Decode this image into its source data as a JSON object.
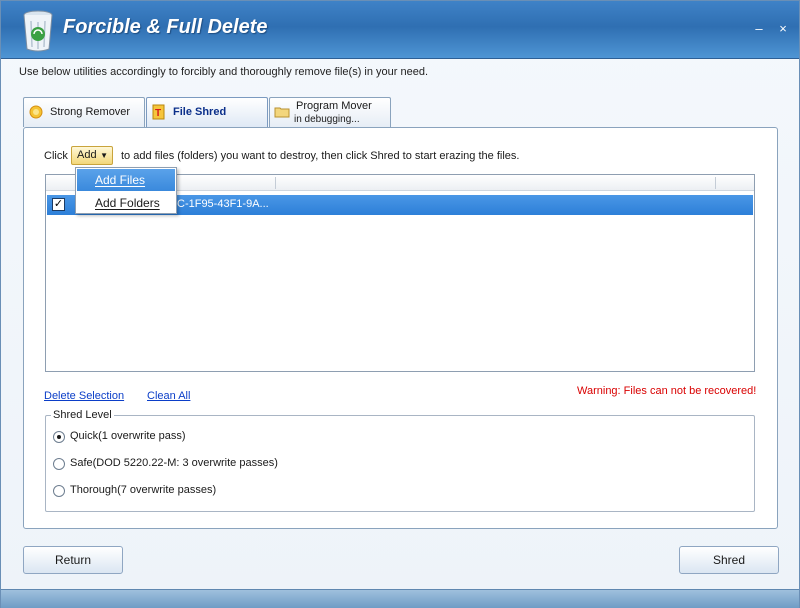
{
  "window": {
    "title": "Forcible & Full Delete",
    "minimize_glyph": "–",
    "close_glyph": "×"
  },
  "instruction": "Use below utilities accordingly to forcibly and thoroughly remove file(s)  in your need.",
  "tabs": [
    {
      "label": "Strong Remover",
      "icon": "sun-icon",
      "active": false
    },
    {
      "label": "File Shred",
      "icon": "shred-icon",
      "active": true
    },
    {
      "label": "Program Mover",
      "sublabel": "in debugging...",
      "icon": "folder-icon",
      "active": false
    }
  ],
  "shred": {
    "click_label": "Click",
    "add_label": "Add",
    "after_add_text": "to add files (folders) you want to destroy, then click Shred to start erazing the files.",
    "dropdown_items": [
      {
        "label": "Add Files",
        "highlighted": true
      },
      {
        "label": "Add Folders",
        "highlighted": false
      }
    ],
    "list_rows": [
      {
        "checked": true,
        "text": "C-1F95-43F1-9A..."
      }
    ],
    "delete_selection_label": "Delete Selection",
    "clear_all_label": "Clean All",
    "warning": "Warning: Files can not be recovered!",
    "level_title": "Shred Level",
    "levels": [
      {
        "label": "Quick(1 overwrite pass)",
        "checked": true
      },
      {
        "label": "Safe(DOD 5220.22-M: 3 overwrite passes)",
        "checked": false
      },
      {
        "label": "Thorough(7 overwrite passes)",
        "checked": false
      }
    ]
  },
  "footer": {
    "return_label": "Return",
    "shred_label": "Shred"
  },
  "colors": {
    "title_bar": "#3f82c7",
    "selection": "#2d7fd8",
    "warning": "#d90000",
    "link": "#0b3ec8"
  }
}
